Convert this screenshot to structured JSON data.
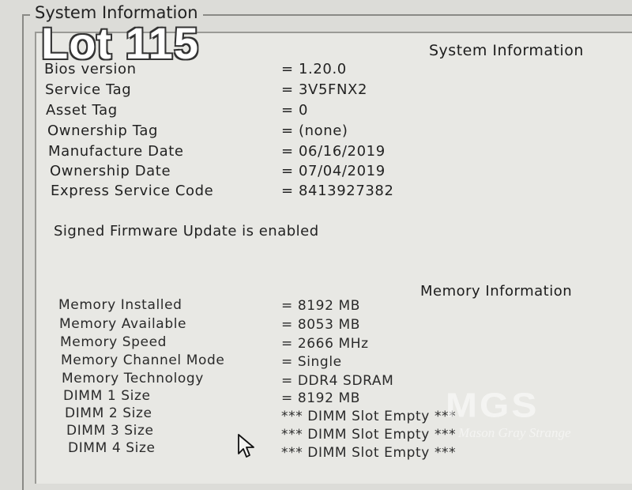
{
  "groupbox": {
    "title": "System Information"
  },
  "overlay": {
    "lot": "Lot 115"
  },
  "system_info": {
    "heading": "System Information",
    "rows": [
      {
        "label": "Bios version",
        "value": "= 1.20.0"
      },
      {
        "label": "Service Tag",
        "value": "= 3V5FNX2"
      },
      {
        "label": "Asset Tag",
        "value": "= 0"
      },
      {
        "label": "Ownership Tag",
        "value": "= (none)"
      },
      {
        "label": "Manufacture Date",
        "value": "= 06/16/2019"
      },
      {
        "label": "Ownership Date",
        "value": "= 07/04/2019"
      },
      {
        "label": "Express Service Code",
        "value": "= 8413927382"
      }
    ],
    "status": "Signed Firmware Update is enabled"
  },
  "memory_info": {
    "heading": "Memory Information",
    "rows": [
      {
        "label": "Memory Installed",
        "value": "= 8192 MB"
      },
      {
        "label": "Memory Available",
        "value": "= 8053 MB"
      },
      {
        "label": "Memory Speed",
        "value": "= 2666 MHz"
      },
      {
        "label": "Memory Channel Mode",
        "value": "= Single"
      },
      {
        "label": "Memory Technology",
        "value": "= DDR4 SDRAM"
      },
      {
        "label": "DIMM 1 Size",
        "value": "= 8192 MB"
      },
      {
        "label": "DIMM 2 Size",
        "value": "*** DIMM Slot Empty ***"
      },
      {
        "label": "DIMM 3 Size",
        "value": "*** DIMM Slot Empty ***"
      },
      {
        "label": "DIMM 4 Size",
        "value": "*** DIMM Slot Empty ***"
      }
    ]
  },
  "watermark": {
    "logo": "MGS",
    "caption": "Mason Gray Strange"
  },
  "icons": {
    "cursor": "mouse-pointer-icon"
  }
}
